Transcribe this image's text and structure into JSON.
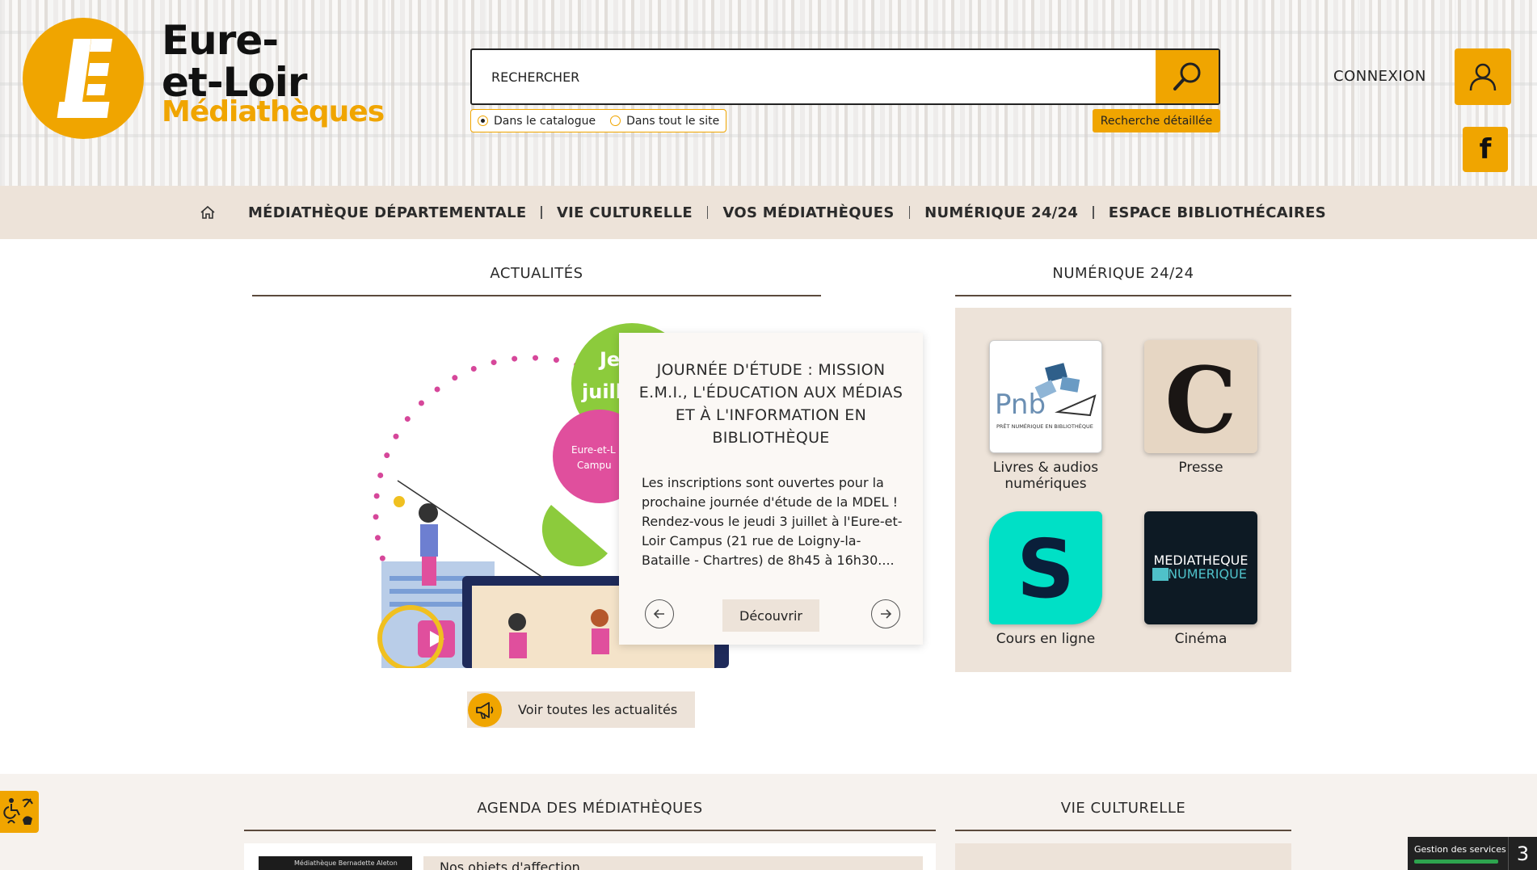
{
  "logo": {
    "line1": "Eure-",
    "line2": "et-Loir",
    "line3": "Médiathèques"
  },
  "search": {
    "placeholder": "RECHERCHER",
    "scope_catalogue": "Dans le catalogue",
    "scope_site": "Dans tout le site",
    "advanced_label": "Recherche détaillée"
  },
  "header": {
    "connexion_label": "CONNEXION",
    "facebook_glyph": "f"
  },
  "nav": {
    "items": [
      "MÉDIATHÈQUE DÉPARTEMENTALE",
      "VIE CULTURELLE",
      "VOS MÉDIATHÈQUES",
      "NUMÉRIQUE 24/24",
      "ESPACE BIBLIOTHÉCAIRES"
    ]
  },
  "actualites": {
    "title": "ACTUALITÉS",
    "illus_text1": "Je",
    "illus_text2": "juille",
    "illus_badge1": "Eure-et-L",
    "illus_badge2": "Campu",
    "card_title": "JOURNÉE D'ÉTUDE : MISSION E.M.I., L'ÉDUCATION AUX MÉDIAS ET À L'INFORMATION EN BIBLIOTHÈQUE",
    "card_text": "Les inscriptions sont ouvertes pour la prochaine journée d'étude de la MDEL ! Rendez-vous le jeudi 3 juillet à l'Eure-et-Loir Campus (21 rue de Loigny-la-Bataille - Chartres) de 8h45 à 16h30....",
    "discover_label": "Découvrir",
    "all_label": "Voir toutes les actualités"
  },
  "numerique": {
    "title": "NUMÉRIQUE 24/24",
    "tiles": [
      {
        "label": "Livres & audios numériques",
        "logo_text": "Pnb",
        "logo_sub": "PRÊT NUMÉRIQUE EN BIBLIOTHÈQUE"
      },
      {
        "label": "Presse",
        "logo_text": "C"
      },
      {
        "label": "Cours en ligne",
        "logo_text": "S"
      },
      {
        "label": "Cinéma",
        "logo_line1": "MEDIATHEQUE",
        "logo_line2": "NUMERIQUE"
      }
    ]
  },
  "agenda": {
    "title": "AGENDA DES MÉDIATHÈQUES",
    "item_thumb": "Médiathèque Bernadette Aleton",
    "item_title": "Nos objets d'affection"
  },
  "vie": {
    "title": "VIE CULTURELLE"
  },
  "gdpr": {
    "label": "Gestion des services",
    "count": "3"
  },
  "colors": {
    "accent": "#f0a500",
    "beige": "#ede3d9",
    "dark": "#2b2b2b"
  }
}
